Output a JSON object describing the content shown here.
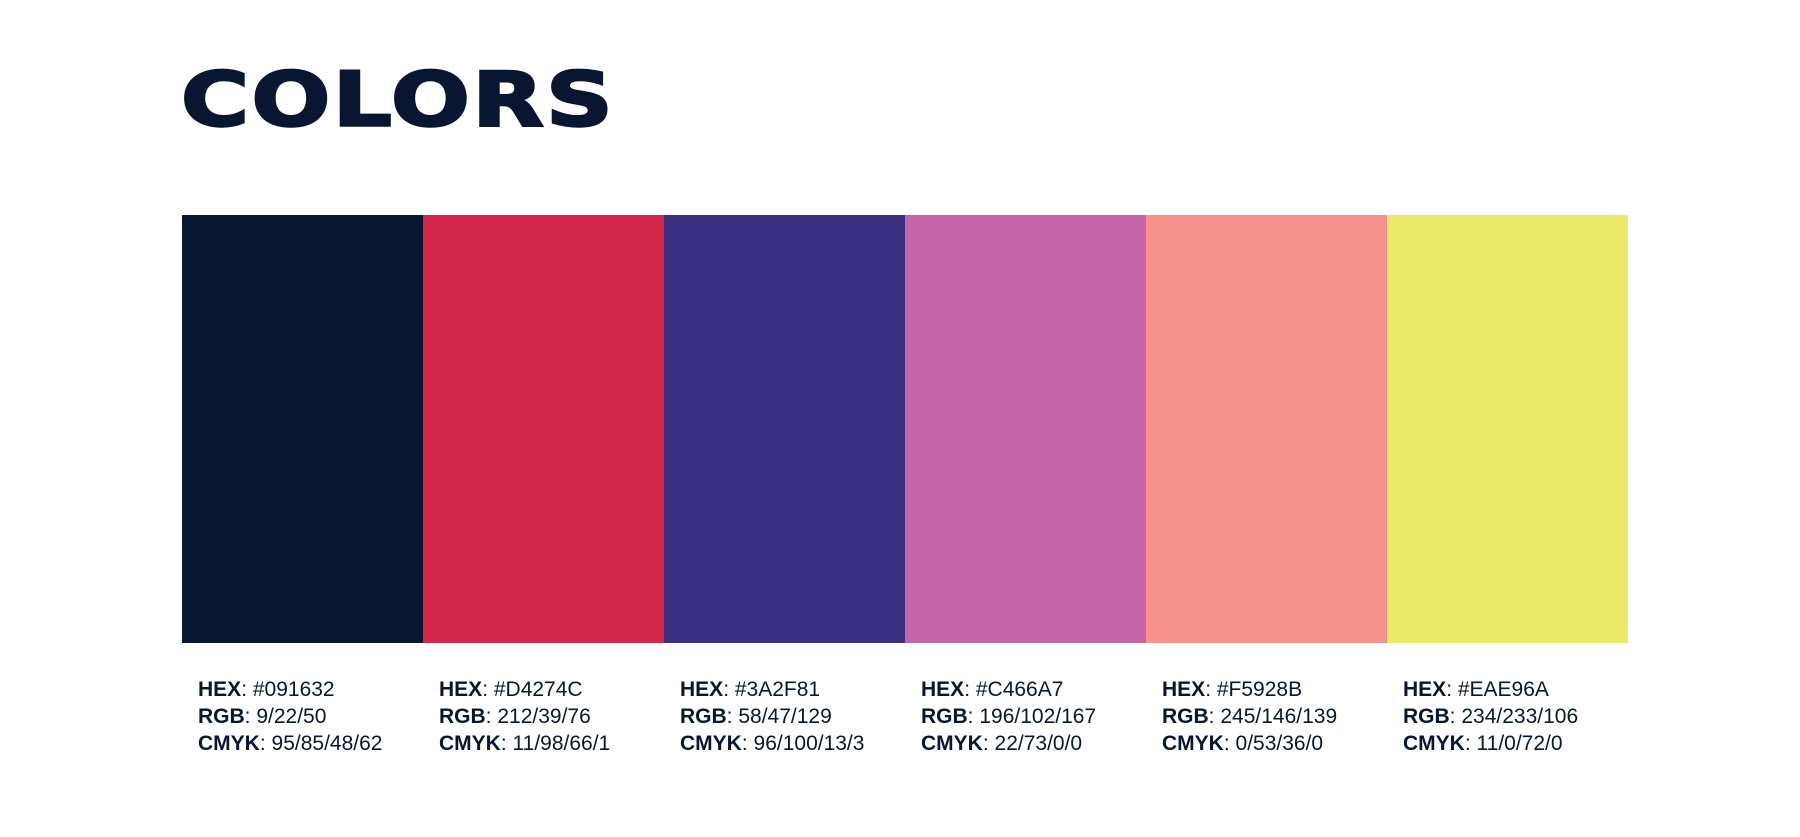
{
  "title": "COLORS",
  "labels": {
    "hex": "HEX",
    "rgb": "RGB",
    "cmyk": "CMYK"
  },
  "colors": [
    {
      "swatch": "#091632",
      "hex": ": #091632",
      "rgb": ": 9/22/50",
      "cmyk": ": 95/85/48/62"
    },
    {
      "swatch": "#D4274C",
      "hex": ": #D4274C",
      "rgb": ": 212/39/76",
      "cmyk": ": 11/98/66/1"
    },
    {
      "swatch": "#3A2F81",
      "hex": ": #3A2F81",
      "rgb": ": 58/47/129",
      "cmyk": ": 96/100/13/3"
    },
    {
      "swatch": "#C466A7",
      "hex": ": #C466A7",
      "rgb": ": 196/102/167",
      "cmyk": ": 22/73/0/0"
    },
    {
      "swatch": "#F5928B",
      "hex": ": #F5928B",
      "rgb": ": 245/146/139",
      "cmyk": ": 0/53/36/0"
    },
    {
      "swatch": "#EAE96A",
      "hex": ": #EAE96A",
      "rgb": ": 234/233/106",
      "cmyk": ": 11/0/72/0"
    }
  ]
}
